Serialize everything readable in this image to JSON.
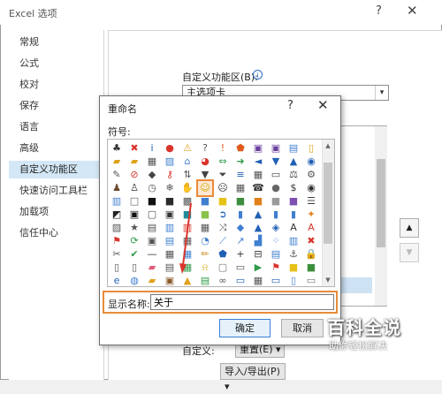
{
  "window": {
    "title": "Excel 选项",
    "help_glyph": "?",
    "close_glyph": "✕"
  },
  "sidebar": {
    "items": [
      "常规",
      "公式",
      "校对",
      "保存",
      "语言",
      "高级",
      "自定义功能区",
      "快速访问工具栏",
      "加载项",
      "信任中心"
    ],
    "selected_index": 6
  },
  "main": {
    "ribbon_label": "自定义功能区(B):",
    "ribbon_info_glyph": "i",
    "ribbon_select_value": "主选项卡",
    "custom_label": "自定义:",
    "reset_label": "重置(E) ▾",
    "import_label": "导入/导出(P) ▾",
    "move_up_glyph": "▲",
    "move_down_glyph": "▼"
  },
  "dialog": {
    "title": "重命名",
    "help_glyph": "?",
    "close_glyph": "✕",
    "symbol_label": "符号:",
    "name_label": "显示名称:",
    "name_value": "关于",
    "ok_label": "确定",
    "cancel_label": "取消",
    "selected_symbol": "smiley-icon"
  },
  "symbols": [
    [
      "org-chart-icon",
      "cancel-icon",
      "info-icon",
      "stop-icon",
      "warning-icon",
      "question-icon",
      "alert-icon",
      "shield-icon",
      "floppy-icon",
      "floppy-edit-icon",
      "document-icon",
      "document-blank-icon"
    ],
    [
      "folders-icon",
      "folder-open-icon",
      "printer-icon",
      "picture-icon",
      "house-icon",
      "pie-icon",
      "arrows-lr-icon",
      "arrow-right-icon",
      "arrow-left-icon",
      "arrow-down-icon",
      "arrow-up-icon",
      "circle-arrow-icon"
    ],
    [
      "pin-icon",
      "forbidden-icon",
      "tag-icon",
      "key-icon",
      "sort-icon",
      "filter-icon",
      "funnel-icon",
      "stack-icon",
      "grid-icon",
      "ruler-icon",
      "scale-icon",
      "gear-icon"
    ],
    [
      "person-icon",
      "people-icon",
      "clock-icon",
      "snowflake-icon",
      "hand-icon",
      "smiley-icon",
      "neutral-face-icon",
      "calculator-icon",
      "phone-icon",
      "piggy-bank-icon",
      "dollar-icon",
      "eye-icon"
    ],
    [
      "palette-icon",
      "square-white-icon",
      "square-black-icon",
      "cube-icon",
      "grid-fill-icon",
      "square-blue-icon",
      "square-yellow-icon",
      "square-green-icon",
      "square-orange-icon",
      "square-gray-icon",
      "square-purple-icon",
      "list-icon"
    ],
    [
      "contrast-icon",
      "frame-black-icon",
      "frame-gray-icon",
      "square-dot-icon",
      "square-teal-icon",
      "square-lime-icon",
      "arrow-circle-icon",
      "bars-icon",
      "triangle-icon",
      "bars-left-icon",
      "bars-right-icon",
      "sparkle-icon"
    ],
    [
      "image-gray-icon",
      "star-icon",
      "chart-icon",
      "chart-bars-icon",
      "chart-column-icon",
      "chart-grid-icon",
      "shuffle-icon",
      "shapes-icon",
      "cone-icon",
      "shapes-blue-icon",
      "text-a-icon",
      "letter-a-icon"
    ],
    [
      "flag-icon",
      "cycle-icon",
      "box-icon",
      "slides-icon",
      "table-icon",
      "chart-pie-icon",
      "chart-line-icon",
      "chart-up-icon",
      "chart-area-icon",
      "chart-scatter-icon",
      "chart-bar-icon",
      "close-x-icon"
    ],
    [
      "tools-icon",
      "check-icon",
      "minus-icon",
      "grid-small-icon",
      "grid-blue-icon",
      "pencil-icon",
      "shield-blue-icon",
      "plus-icon",
      "minus-box-icon",
      "sheet-icon",
      "anchor-icon",
      "lock-icon"
    ],
    [
      "page-icon",
      "page-fold-icon",
      "eraser-icon",
      "cards-icon",
      "table-green-icon",
      "bell-icon",
      "box-gray-icon",
      "keyboard-icon",
      "play-icon",
      "flag-red-icon",
      "square-yellow2-icon",
      "square-green2-icon"
    ],
    [
      "ie-icon",
      "globe-icon",
      "folder-yellow-icon",
      "box-brown-icon",
      "lamp-icon",
      "book-icon",
      "chain-icon",
      "window-icon",
      "calendar-icon",
      "window-blue-icon",
      "page-blue-icon",
      "window-gray-icon"
    ]
  ],
  "glyphs": {
    "org-chart-icon": "♣",
    "cancel-icon": "✖",
    "info-icon": "i",
    "stop-icon": "●",
    "warning-icon": "⚠",
    "question-icon": "?",
    "alert-icon": "!",
    "shield-icon": "⬟",
    "floppy-icon": "▣",
    "floppy-edit-icon": "▣",
    "document-icon": "▤",
    "document-blank-icon": "▯",
    "folders-icon": "▰",
    "folder-open-icon": "▰",
    "printer-icon": "▦",
    "picture-icon": "▨",
    "house-icon": "⌂",
    "pie-icon": "◕",
    "arrows-lr-icon": "⇔",
    "arrow-right-icon": "➜",
    "arrow-left-icon": "◄",
    "arrow-down-icon": "▼",
    "arrow-up-icon": "▲",
    "circle-arrow-icon": "◉",
    "pin-icon": "✎",
    "forbidden-icon": "⊘",
    "tag-icon": "◆",
    "key-icon": "⚷",
    "sort-icon": "⇅",
    "filter-icon": "▼",
    "funnel-icon": "⏷",
    "stack-icon": "≡",
    "grid-icon": "▦",
    "ruler-icon": "▭",
    "scale-icon": "⚖",
    "gear-icon": "⚙",
    "person-icon": "♟",
    "people-icon": "♙",
    "clock-icon": "◷",
    "snowflake-icon": "❄",
    "hand-icon": "✋",
    "smiley-icon": "☺",
    "neutral-face-icon": "☹",
    "calculator-icon": "▦",
    "phone-icon": "☎",
    "piggy-bank-icon": "●",
    "dollar-icon": "$",
    "eye-icon": "◉",
    "palette-icon": "▥",
    "square-white-icon": "□",
    "square-black-icon": "■",
    "cube-icon": "■",
    "grid-fill-icon": "▩",
    "square-blue-icon": "■",
    "square-yellow-icon": "■",
    "square-green-icon": "■",
    "square-orange-icon": "■",
    "square-gray-icon": "■",
    "square-purple-icon": "■",
    "list-icon": "☰",
    "contrast-icon": "◩",
    "frame-black-icon": "▣",
    "frame-gray-icon": "▢",
    "square-dot-icon": "▣",
    "square-teal-icon": "■",
    "square-lime-icon": "■",
    "arrow-circle-icon": "➲",
    "bars-icon": "▮",
    "triangle-icon": "▲",
    "bars-left-icon": "▮",
    "bars-right-icon": "▮",
    "sparkle-icon": "✦",
    "image-gray-icon": "▨",
    "star-icon": "★",
    "chart-icon": "▤",
    "chart-bars-icon": "▥",
    "chart-column-icon": "▥",
    "chart-grid-icon": "▦",
    "shuffle-icon": "⤨",
    "shapes-icon": "◆",
    "cone-icon": "▲",
    "shapes-blue-icon": "◈",
    "text-a-icon": "A",
    "letter-a-icon": "A",
    "flag-icon": "⚑",
    "cycle-icon": "⟳",
    "box-icon": "▣",
    "slides-icon": "▤",
    "table-icon": "▦",
    "chart-pie-icon": "◔",
    "chart-line-icon": "⟋",
    "chart-up-icon": "↗",
    "chart-area-icon": "▟",
    "chart-scatter-icon": "⁘",
    "chart-bar-icon": "▥",
    "close-x-icon": "✖",
    "tools-icon": "✂",
    "check-icon": "✔",
    "minus-icon": "—",
    "grid-small-icon": "▦",
    "grid-blue-icon": "▦",
    "pencil-icon": "✏",
    "shield-blue-icon": "⬟",
    "plus-icon": "+",
    "minus-box-icon": "⊟",
    "sheet-icon": "▤",
    "anchor-icon": "⚓",
    "lock-icon": "🔒",
    "page-icon": "▯",
    "page-fold-icon": "▯",
    "eraser-icon": "▰",
    "cards-icon": "▤",
    "table-green-icon": "▦",
    "bell-icon": "⍾",
    "box-gray-icon": "▢",
    "keyboard-icon": "▭",
    "play-icon": "▶",
    "flag-red-icon": "⚑",
    "square-yellow2-icon": "■",
    "square-green2-icon": "■",
    "ie-icon": "e",
    "globe-icon": "◍",
    "folder-yellow-icon": "▰",
    "box-brown-icon": "▣",
    "lamp-icon": "▲",
    "book-icon": "▤",
    "chain-icon": "∞",
    "window-icon": "▭",
    "calendar-icon": "▦",
    "window-blue-icon": "▭",
    "page-blue-icon": "▯",
    "window-gray-icon": "▭"
  },
  "glyph_colors": {
    "org-chart-icon": "#333",
    "cancel-icon": "#d9352c",
    "info-icon": "#1f5fb4",
    "stop-icon": "#d9352c",
    "warning-icon": "#e0a21a",
    "question-icon": "#555",
    "alert-icon": "#e05a1c",
    "shield-icon": "#e05a1c",
    "floppy-icon": "#6a3f9e",
    "floppy-edit-icon": "#6a3f9e",
    "document-icon": "#3f7fd0",
    "document-blank-icon": "#e0a21a",
    "folders-icon": "#e0a21a",
    "folder-open-icon": "#e0a21a",
    "printer-icon": "#555",
    "picture-icon": "#3f7fd0",
    "house-icon": "#3f7fd0",
    "pie-icon": "#d9352c",
    "arrows-lr-icon": "#2e9b48",
    "arrow-right-icon": "#2e9b48",
    "arrow-left-icon": "#1f5fb4",
    "arrow-down-icon": "#1f5fb4",
    "arrow-up-icon": "#1f5fb4",
    "circle-arrow-icon": "#1f5fb4",
    "pin-icon": "#555",
    "forbidden-icon": "#d9352c",
    "tag-icon": "#444",
    "key-icon": "#d9352c",
    "sort-icon": "#555",
    "filter-icon": "#444",
    "funnel-icon": "#444",
    "stack-icon": "#1f5fb4",
    "grid-icon": "#555",
    "ruler-icon": "#444",
    "scale-icon": "#444",
    "gear-icon": "#555",
    "person-icon": "#6b4a2b",
    "people-icon": "#333",
    "clock-icon": "#555",
    "snowflake-icon": "#555",
    "hand-icon": "#c79a50",
    "smiley-icon": "#d1a800",
    "neutral-face-icon": "#333",
    "calculator-icon": "#555",
    "phone-icon": "#333",
    "piggy-bank-icon": "#666",
    "dollar-icon": "#333",
    "eye-icon": "#333",
    "palette-icon": "#3f7fd0",
    "square-white-icon": "#666",
    "square-black-icon": "#111",
    "cube-icon": "#2a2a2a",
    "grid-fill-icon": "#555",
    "square-blue-icon": "#3f7fd0",
    "square-yellow-icon": "#e6c218",
    "square-green-icon": "#3d8f3d",
    "square-orange-icon": "#e0801c",
    "square-gray-icon": "#9a9a9a",
    "square-purple-icon": "#7c4fb0",
    "list-icon": "#444",
    "contrast-icon": "#222",
    "frame-black-icon": "#111",
    "frame-gray-icon": "#555",
    "square-dot-icon": "#333",
    "square-teal-icon": "#1f8a9a",
    "square-lime-icon": "#8bc34a",
    "arrow-circle-icon": "#1f5fb4",
    "bars-icon": "#3f7fd0",
    "triangle-icon": "#1f5fb4",
    "bars-left-icon": "#3f7fd0",
    "bars-right-icon": "#3f7fd0",
    "sparkle-icon": "#e0801c",
    "image-gray-icon": "#555",
    "star-icon": "#555",
    "chart-icon": "#555",
    "chart-bars-icon": "#3f7fd0",
    "chart-column-icon": "#d9352c",
    "chart-grid-icon": "#555",
    "shuffle-icon": "#555",
    "shapes-icon": "#3f7fd0",
    "cone-icon": "#1f5fb4",
    "shapes-blue-icon": "#1f5fb4",
    "text-a-icon": "#333",
    "letter-a-icon": "#d9352c",
    "flag-icon": "#d9352c",
    "cycle-icon": "#2e9b48",
    "box-icon": "#555",
    "slides-icon": "#3f7fd0",
    "table-icon": "#555",
    "chart-pie-icon": "#3f7fd0",
    "chart-line-icon": "#3f7fd0",
    "chart-up-icon": "#3f7fd0",
    "chart-area-icon": "#3f7fd0",
    "chart-scatter-icon": "#3f7fd0",
    "chart-bar-icon": "#3f7fd0",
    "close-x-icon": "#d9352c",
    "tools-icon": "#555",
    "check-icon": "#2e9b48",
    "minus-icon": "#333",
    "grid-small-icon": "#555",
    "grid-blue-icon": "#3f7fd0",
    "pencil-icon": "#d08a20",
    "shield-blue-icon": "#1f5fb4",
    "plus-icon": "#333",
    "minus-box-icon": "#333",
    "sheet-icon": "#3f7fd0",
    "anchor-icon": "#555",
    "lock-icon": "#e0a21a",
    "page-icon": "#555",
    "page-fold-icon": "#555",
    "eraser-icon": "#e05a7c",
    "cards-icon": "#555",
    "table-green-icon": "#2e9b48",
    "bell-icon": "#d9a818",
    "box-gray-icon": "#777",
    "keyboard-icon": "#555",
    "play-icon": "#2e9b48",
    "flag-red-icon": "#d9352c",
    "square-yellow2-icon": "#e6c218",
    "square-green2-icon": "#3d8f3d",
    "ie-icon": "#1f5fb4",
    "globe-icon": "#3f7fd0",
    "folder-yellow-icon": "#e0a21a",
    "box-brown-icon": "#8a5a2b",
    "lamp-icon": "#e0a21a",
    "book-icon": "#2e9b48",
    "chain-icon": "#555",
    "window-icon": "#1f5fb4",
    "calendar-icon": "#555",
    "window-blue-icon": "#1f5fb4",
    "page-blue-icon": "#3f7fd0",
    "window-gray-icon": "#777"
  },
  "watermark": {
    "text": "百科全说",
    "sub": "助你轻松解决"
  },
  "colors": {
    "accent": "#e98b3b",
    "sidebar_selected": "#d3e7f6",
    "ok_border": "#3c7fd6",
    "arrow": "#d9352c"
  }
}
